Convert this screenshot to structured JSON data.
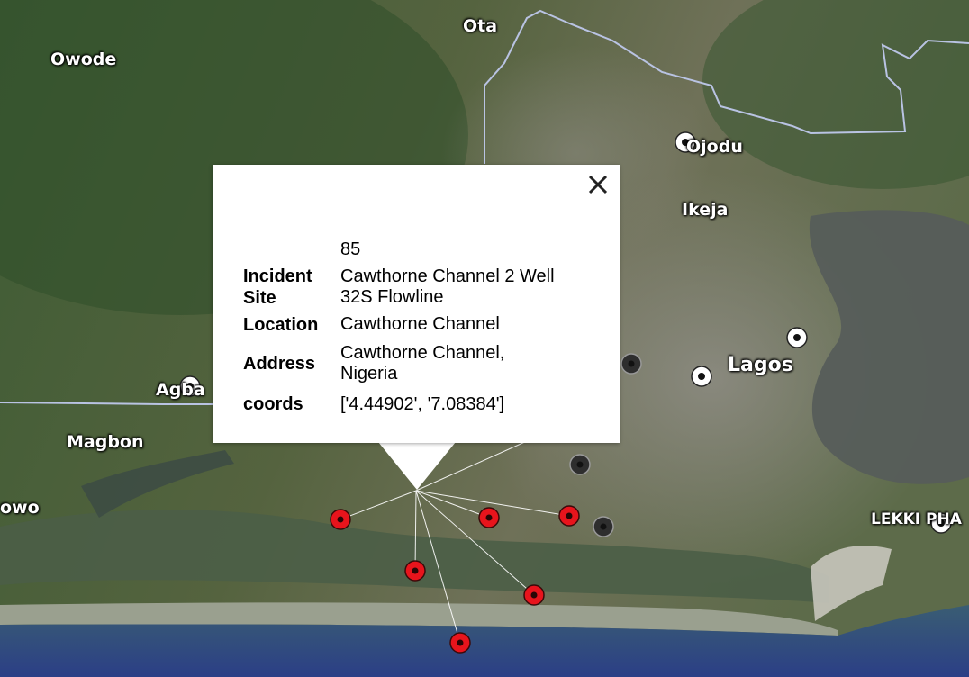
{
  "map": {
    "place_labels": {
      "ota": "Ota",
      "owode": "Owode",
      "ojodu": "Ojodu",
      "ikeja": "Ikeja",
      "lagos": "Lagos",
      "agba": "Agba",
      "magbon": "Magbon",
      "owo": "owo",
      "lekki": "LEKKI PHA"
    },
    "colors": {
      "incident_marker": "#e8141c",
      "cluster_marker_dark": "#2e2e2e",
      "cluster_marker_white": "#ffffff",
      "border_line": "#b9c3e3",
      "popup_background": "#ffffff"
    }
  },
  "popup": {
    "id_value": "85",
    "rows": [
      {
        "key": "Incident Site",
        "value": "Cawthorne Channel 2 Well 32S Flowline"
      },
      {
        "key": "Location",
        "value": "Cawthorne Channel"
      },
      {
        "key": "Address",
        "value": "Cawthorne Channel, Nigeria"
      },
      {
        "key": "coords",
        "value": "['4.44902', '7.08384']"
      }
    ],
    "close_icon": "close-icon"
  }
}
